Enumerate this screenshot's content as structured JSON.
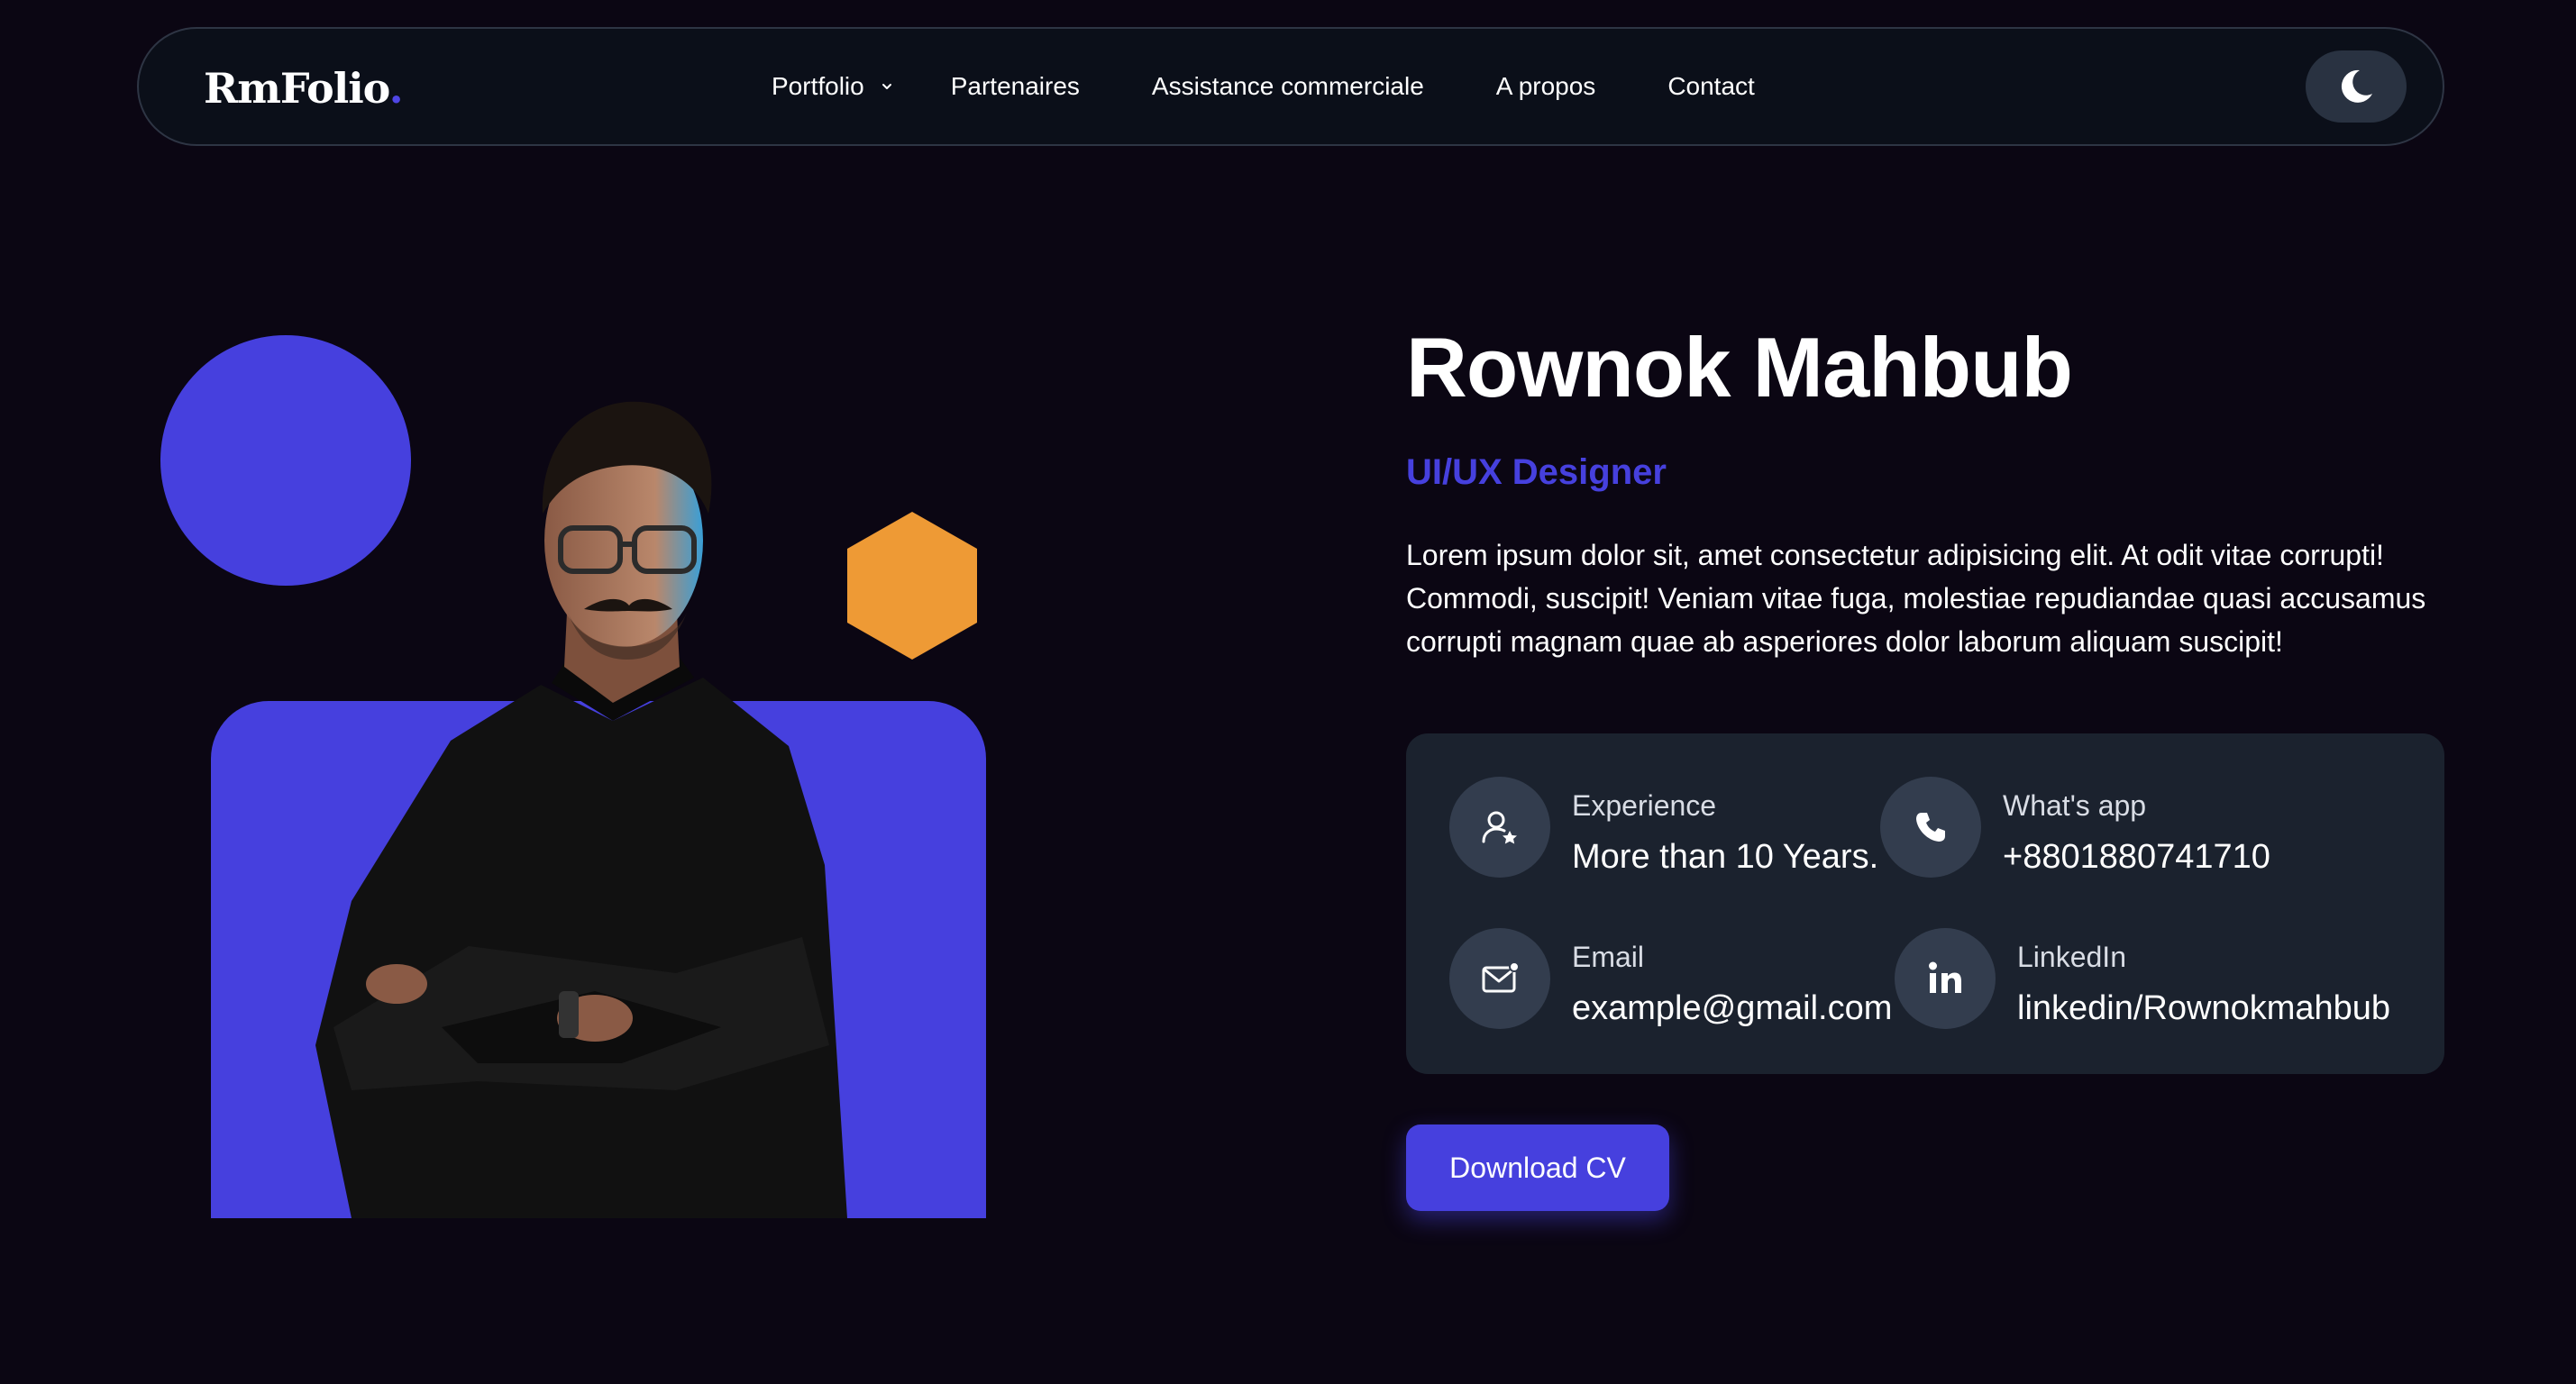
{
  "nav": {
    "logo": "RmFolio",
    "logo_dot": ".",
    "links": [
      "Portfolio",
      "Partenaires",
      "Assistance commerciale",
      "A propos",
      "Contact"
    ],
    "theme_toggle_icon": "moon-icon"
  },
  "hero": {
    "name": "Rownok Mahbub",
    "role": "UI/UX Designer",
    "bio": "Lorem ipsum dolor sit, amet consectetur adipisicing elit. At odit vitae corrupti! Commodi, suscipit! Veniam vitae fuga, molestiae repudiandae quasi accusamus corrupti magnam quae ab asperiores dolor laborum aliquam suscipit!",
    "info": {
      "experience": {
        "label": "Experience",
        "value": "More than 10 Years.",
        "icon": "user-star-icon"
      },
      "whatsapp": {
        "label": "What's app",
        "value": "+8801880741710",
        "icon": "phone-icon"
      },
      "email": {
        "label": "Email",
        "value": "example@gmail.com",
        "icon": "mail-icon"
      },
      "linkedin": {
        "label": "LinkedIn",
        "value": "linkedin/Rownokmahbub",
        "icon": "linkedin-icon"
      }
    },
    "cv_button": "Download CV"
  },
  "colors": {
    "accent": "#4640de",
    "hexagon": "#ee9a35",
    "background": "#0b0613",
    "card": "#1b222e"
  }
}
